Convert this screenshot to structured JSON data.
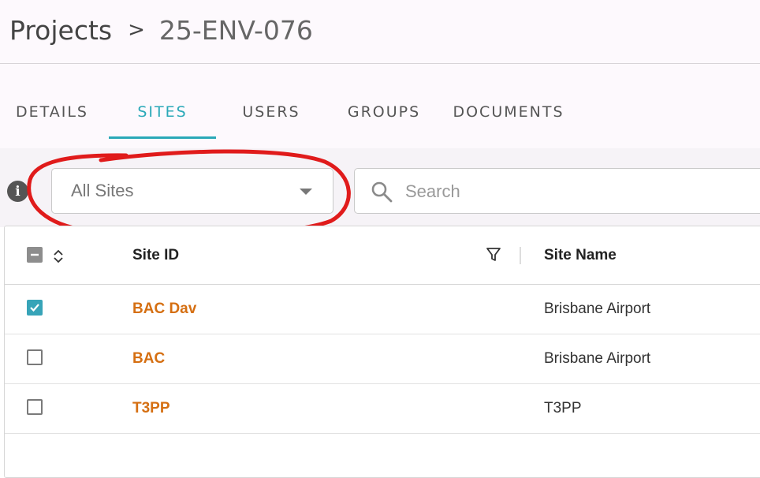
{
  "breadcrumb": {
    "root": "Projects",
    "separator": ">",
    "current": "25-ENV-076"
  },
  "tabs": [
    {
      "label": "DETAILS",
      "active": false
    },
    {
      "label": "SITES",
      "active": true
    },
    {
      "label": "USERS",
      "active": false
    },
    {
      "label": "GROUPS",
      "active": false
    },
    {
      "label": "DOCUMENTS",
      "active": false
    }
  ],
  "toolbar": {
    "info_icon": "info-icon",
    "site_filter": {
      "selected": "All Sites"
    },
    "search": {
      "placeholder": "Search",
      "value": ""
    }
  },
  "table": {
    "columns": {
      "site_id": "Site ID",
      "site_name": "Site Name"
    },
    "header_checkbox": "indeterminate",
    "rows": [
      {
        "site_id": "BAC Dav",
        "site_name": "Brisbane Airport",
        "checked": true
      },
      {
        "site_id": "BAC",
        "site_name": "Brisbane Airport",
        "checked": false
      },
      {
        "site_id": "T3PP",
        "site_name": "T3PP",
        "checked": false
      }
    ]
  },
  "colors": {
    "accent": "#2aa9b8",
    "checkbox_checked": "#37a4b8",
    "site_id_text": "#d56f12",
    "highlight_circle": "#e01b1b"
  }
}
